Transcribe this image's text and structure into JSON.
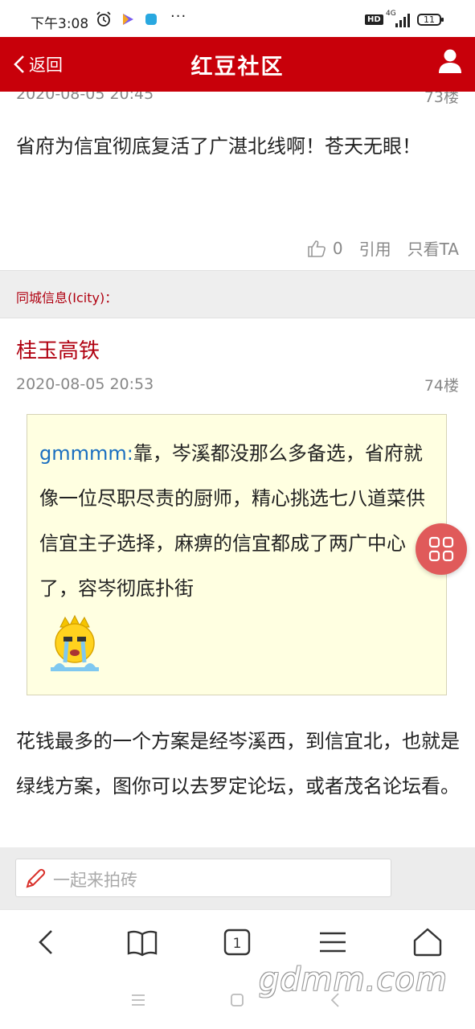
{
  "status_bar": {
    "time": "下午3:08",
    "more": "···",
    "hd": "HD",
    "network": "4G",
    "battery": "11"
  },
  "header": {
    "back_label": "返回",
    "title": "红豆社区",
    "brand_color": "#c8000a"
  },
  "post_73": {
    "timestamp": "2020-08-05 20:45",
    "floor": "73楼",
    "text": "省府为信宜彻底复活了广湛北线啊！苍天无眼！",
    "like_count": "0",
    "quote_label": "引用",
    "only_label": "只看TA"
  },
  "post_74": {
    "source": "同城信息(Icity)：",
    "author": "桂玉高铁",
    "timestamp": "2020-08-05 20:53",
    "floor": "74楼",
    "quote": {
      "name": "gmmmm:",
      "text": "靠，岑溪都没那么多备选，省府就像一位尽职尽责的厨师，精心挑选七八道菜供信宜主子选择，麻痹的信宜都成了两广中心了，容岑彻底扑街"
    },
    "text": "花钱最多的一个方案是经岑溪西，到信宜北，也就是绿线方案，图你可以去罗定论坛，或者茂名论坛看。"
  },
  "reply": {
    "placeholder": "一起来拍砖"
  },
  "browser_bar": {
    "tab_count": "1"
  },
  "watermark": "gdmm.com",
  "icons": [
    "chevron-left-icon",
    "user-icon",
    "thumbs-up-icon",
    "grid-icon",
    "pencil-icon",
    "back-icon",
    "book-icon",
    "tabs-icon",
    "menu-icon",
    "home-icon",
    "alarm-icon"
  ]
}
